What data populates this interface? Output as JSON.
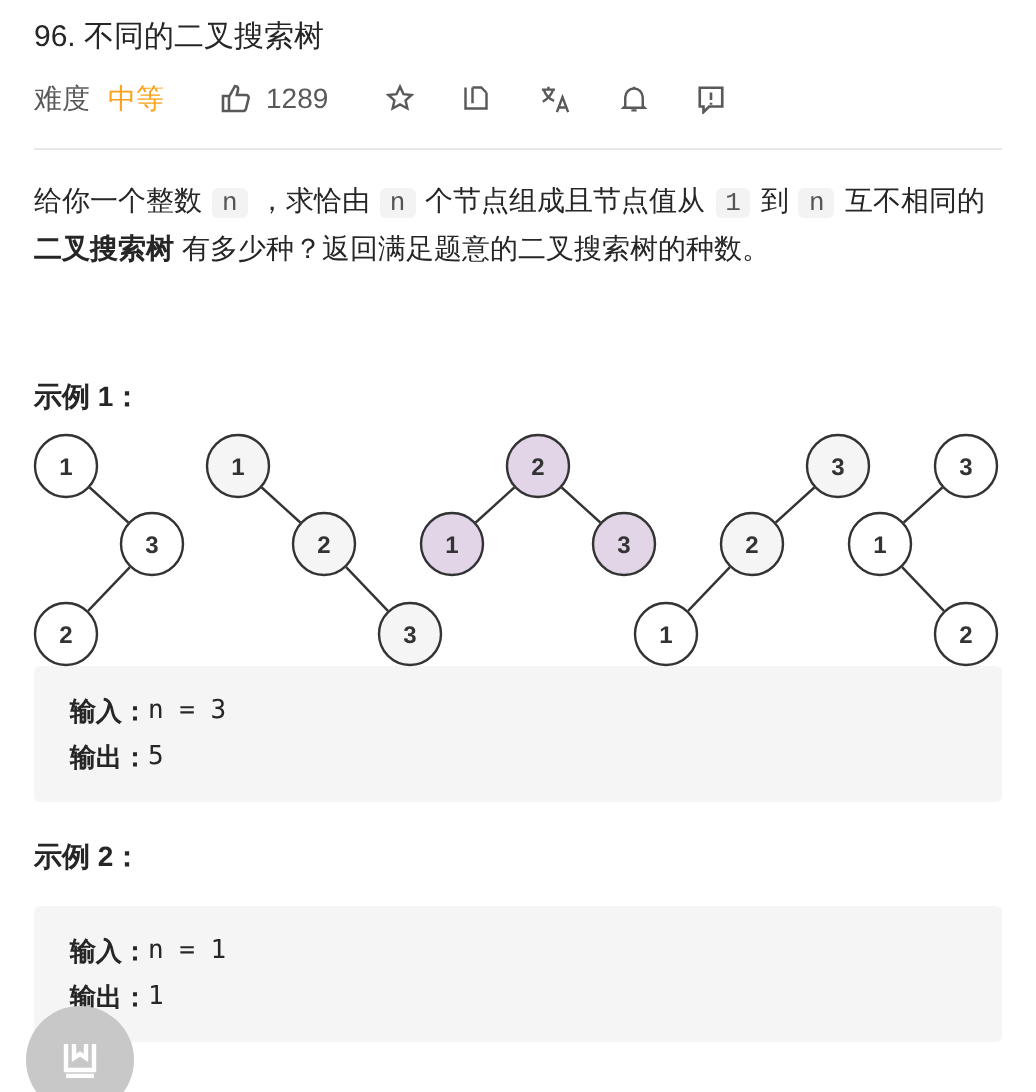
{
  "title": "96. 不同的二叉搜索树",
  "meta": {
    "difficulty_label": "难度",
    "difficulty": "中等",
    "likes": "1289"
  },
  "description": [
    {
      "kind": "text",
      "text": "给你一个整数"
    },
    {
      "kind": "code",
      "text": "n"
    },
    {
      "kind": "text",
      "text": "，求恰由"
    },
    {
      "kind": "code",
      "text": "n"
    },
    {
      "kind": "text",
      "text": "个节点组成且节点值从"
    },
    {
      "kind": "code",
      "text": "1"
    },
    {
      "kind": "text",
      "text": "到"
    },
    {
      "kind": "code",
      "text": "n"
    },
    {
      "kind": "text",
      "text": "互不相同的**二叉搜索树** 有多少种？返回满足题意的二叉搜索树的种数。"
    }
  ],
  "examples": [
    {
      "heading": "示例 1：",
      "trees": [
        {
          "label": "1",
          "color": "#ffffff",
          "right": {
            "label": "3",
            "color": "#ffffff",
            "left": {
              "label": "2",
              "color": "#ffffff"
            }
          }
        },
        {
          "label": "1",
          "color": "#f5f5f5",
          "right": {
            "label": "2",
            "color": "#f5f5f5",
            "right": {
              "label": "3",
              "color": "#f5f5f5"
            }
          }
        },
        {
          "label": "2",
          "color": "#e1d5e7",
          "left": {
            "label": "1",
            "color": "#e1d5e7"
          },
          "right": {
            "label": "3",
            "color": "#e1d5e7"
          }
        },
        {
          "label": "3",
          "color": "#f5f5f5",
          "left": {
            "label": "2",
            "color": "#f5f5f5",
            "left": {
              "label": "1",
              "color": "#ffffff"
            }
          }
        },
        {
          "label": "3",
          "color": "#ffffff",
          "left": {
            "label": "1",
            "color": "#ffffff",
            "right": {
              "label": "2",
              "color": "#ffffff"
            }
          }
        }
      ],
      "lines": [
        {
          "label": "输入：",
          "value": "n = 3"
        },
        {
          "label": "输出：",
          "value": "5"
        }
      ]
    },
    {
      "heading": "示例 2：",
      "lines": [
        {
          "label": "输入：",
          "value": "n = 1"
        },
        {
          "label": "输出：",
          "value": "1"
        }
      ]
    }
  ]
}
